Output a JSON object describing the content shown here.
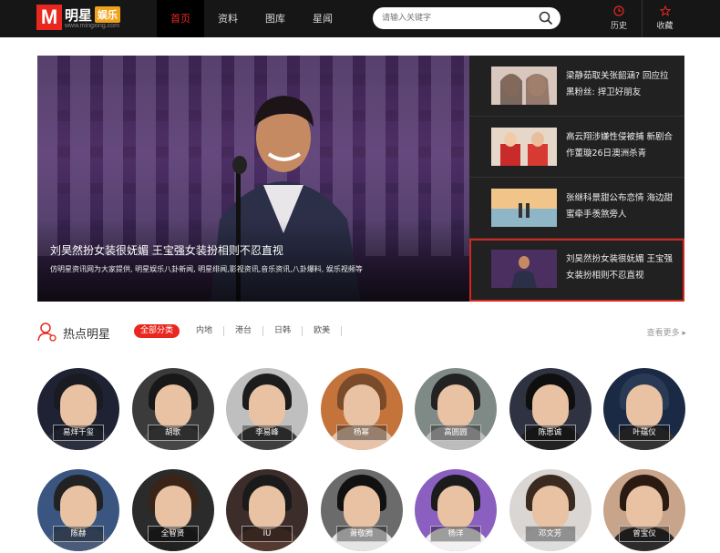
{
  "header": {
    "logo_letter": "M",
    "logo_text": "明星",
    "logo_badge": "娱乐",
    "logo_url": "www.mingxing.com",
    "nav": [
      "首页",
      "资料",
      "图库",
      "星闻"
    ],
    "search_placeholder": "请输入关键字",
    "tools": [
      {
        "label": "历史",
        "icon": "clock-icon"
      },
      {
        "label": "收藏",
        "icon": "star-icon"
      }
    ]
  },
  "hero": {
    "title": "刘昊然扮女装很妩媚 王宝强女装扮相则不忍直视",
    "desc": "仿明星资讯网为大家提供, 明星娱乐八卦新闻, 明星绯闻,影视资讯,音乐资讯,八卦爆料, 娱乐视频等",
    "side_items": [
      {
        "text": "梁静茹取关张韶涵? 回应拉黑粉丝: 捍卫好朋友"
      },
      {
        "text": "高云翔涉嫌性侵被捕 新剧合作董璇26日澳洲杀青"
      },
      {
        "text": "张继科景甜公布恋情 海边甜蜜牵手羡煞旁人"
      },
      {
        "text": "刘昊然扮女装很妩媚 王宝强女装扮相则不忍直视"
      }
    ]
  },
  "hot": {
    "title": "热点明星",
    "tabs": [
      "全部分类",
      "内地",
      "港台",
      "日韩",
      "欧美"
    ],
    "more": "查看更多"
  },
  "stars": [
    {
      "name": "易烊千玺"
    },
    {
      "name": "胡歌"
    },
    {
      "name": "李易峰"
    },
    {
      "name": "杨幂"
    },
    {
      "name": "高圆圆"
    },
    {
      "name": "陈思诚"
    },
    {
      "name": "叶蕴仪"
    },
    {
      "name": "陈赫"
    },
    {
      "name": "全智贤"
    },
    {
      "name": "IU"
    },
    {
      "name": "萧敬腾"
    },
    {
      "name": "杨洋"
    },
    {
      "name": "邓文芳"
    },
    {
      "name": "曾宝仪"
    }
  ]
}
